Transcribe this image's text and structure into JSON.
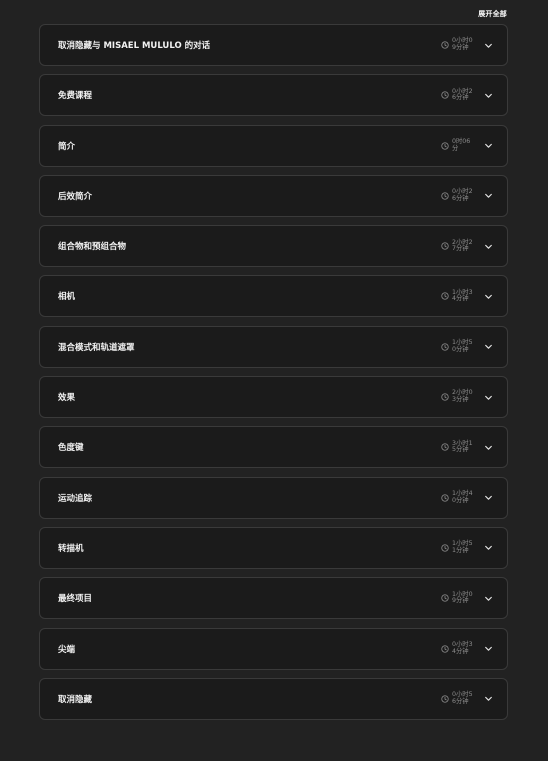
{
  "header": {
    "expand_all_label": "展开全部"
  },
  "colors": {
    "background": "#222222",
    "card": "#1b1b1b",
    "border": "#3a3a3a",
    "muted_text": "#8c8c8c"
  },
  "icons": {
    "duration": "clock-icon",
    "toggle": "chevron-down-icon"
  },
  "sections": [
    {
      "title": "取消隐藏与 MISAEL MULULO 的对话",
      "duration": "0小时09分钟"
    },
    {
      "title": "免费课程",
      "duration": "0小时26分钟"
    },
    {
      "title": "简介",
      "duration": "0时06分"
    },
    {
      "title": "后效简介",
      "duration": "0小时26分钟"
    },
    {
      "title": "组合物和预组合物",
      "duration": "2小时27分钟"
    },
    {
      "title": "相机",
      "duration": "1小时34分钟"
    },
    {
      "title": "混合模式和轨道遮罩",
      "duration": "1小时50分钟"
    },
    {
      "title": "效果",
      "duration": "2小时03分钟"
    },
    {
      "title": "色度键",
      "duration": "3小时15分钟"
    },
    {
      "title": "运动追踪",
      "duration": "1小时40分钟"
    },
    {
      "title": "转描机",
      "duration": "1小时51分钟"
    },
    {
      "title": "最终项目",
      "duration": "1小时09分钟"
    },
    {
      "title": "尖端",
      "duration": "0小时34分钟"
    },
    {
      "title": "取消隐藏",
      "duration": "0小时56分钟"
    }
  ]
}
